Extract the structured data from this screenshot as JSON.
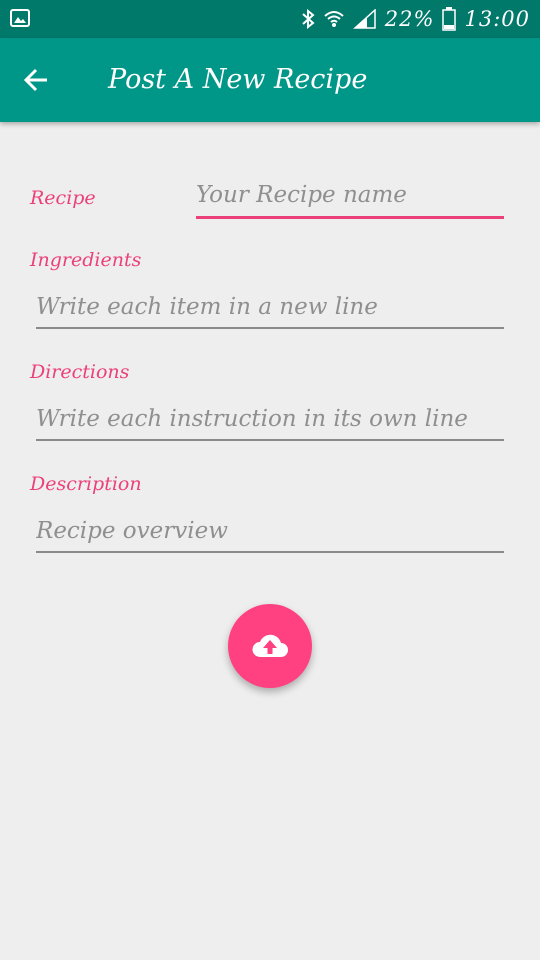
{
  "status_bar": {
    "battery_text": "22%",
    "time": "13:00",
    "icons": [
      "gallery-icon",
      "bluetooth-icon",
      "wifi-icon",
      "signal-icon",
      "battery-icon"
    ]
  },
  "app_bar": {
    "title": "Post A New Recipe",
    "back_icon": "arrow-left-icon",
    "color": "#009688"
  },
  "form": {
    "recipe": {
      "label": "Recipe",
      "placeholder": "Your Recipe name"
    },
    "ingredients": {
      "label": "Ingredients",
      "placeholder": "Write each item in a new line"
    },
    "directions": {
      "label": "Directions",
      "placeholder": "Write each instruction in its own line"
    },
    "description": {
      "label": "Description",
      "placeholder": "Recipe overview"
    }
  },
  "fab": {
    "icon": "cloud-upload-icon",
    "color": "#ff4081"
  },
  "colors": {
    "accent": "#ec407a",
    "status_bar": "#00796b",
    "background": "#eeeeee"
  }
}
